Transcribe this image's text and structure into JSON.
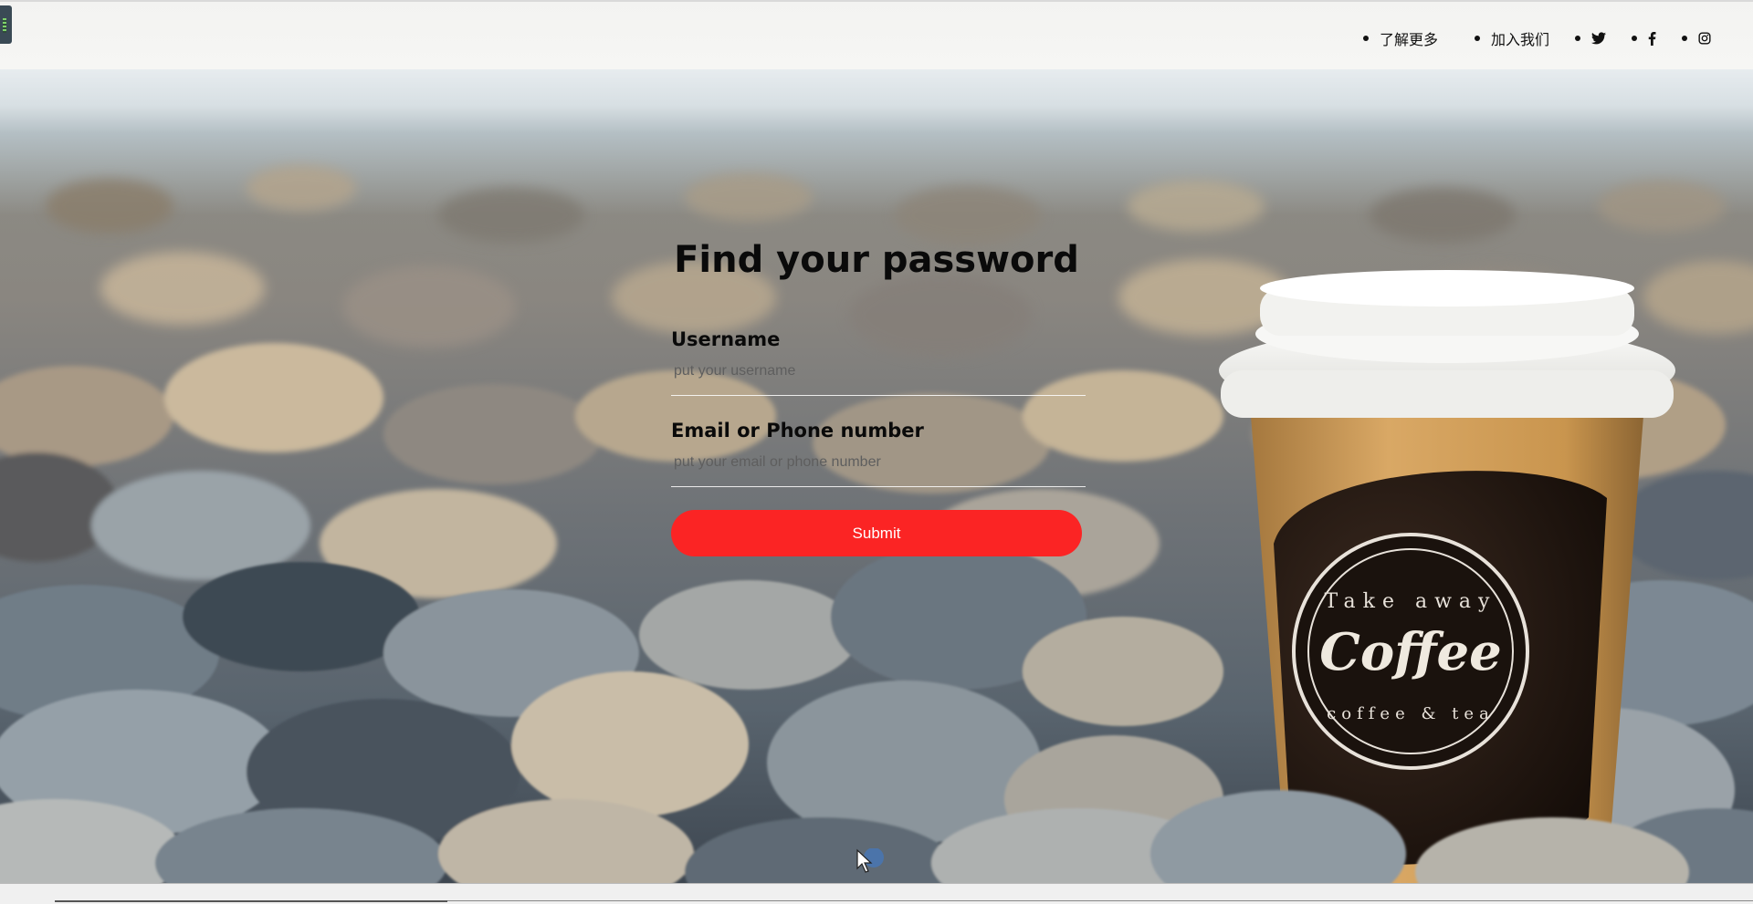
{
  "nav": {
    "items": [
      {
        "label": "了解更多"
      },
      {
        "label": "加入我们"
      }
    ],
    "social": [
      {
        "icon": "twitter-icon"
      },
      {
        "icon": "facebook-icon"
      },
      {
        "icon": "instagram-icon"
      }
    ]
  },
  "form": {
    "title": "Find your password",
    "username_label": "Username",
    "username_placeholder": "put your username",
    "contact_label": "Email or Phone number",
    "contact_placeholder": "put your email or phone number",
    "submit_label": "Submit"
  },
  "cup": {
    "ring_top": "Take away",
    "brand": "Coffee",
    "ring_bottom": "coffee & tea"
  },
  "colors": {
    "accent": "#fb2424",
    "header_bg": "#f5f5f3"
  }
}
